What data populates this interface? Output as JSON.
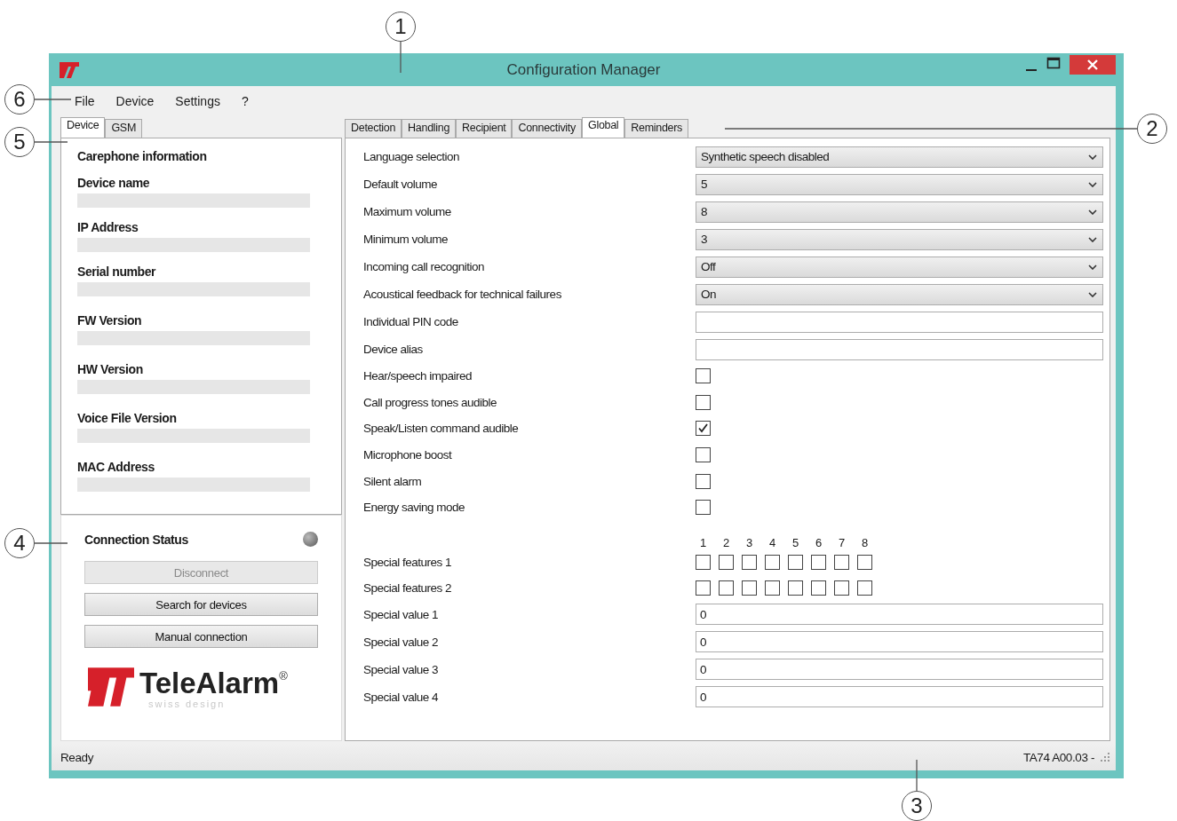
{
  "callouts": [
    {
      "label": "1"
    },
    {
      "label": "6"
    },
    {
      "label": "2"
    },
    {
      "label": "5"
    },
    {
      "label": "4"
    },
    {
      "label": "3"
    }
  ],
  "window": {
    "title": "Configuration Manager"
  },
  "menu": [
    "File",
    "Device",
    "Settings",
    "?"
  ],
  "left_tabs": [
    {
      "label": "Device",
      "selected": true
    },
    {
      "label": "GSM",
      "selected": false
    }
  ],
  "device_info": {
    "heading": "Carephone information",
    "fields": [
      {
        "label": "Device name"
      },
      {
        "label": "IP Address"
      },
      {
        "label": "Serial number"
      },
      {
        "label": "FW Version"
      },
      {
        "label": "HW Version"
      },
      {
        "label": "Voice File Version"
      },
      {
        "label": "MAC Address"
      }
    ]
  },
  "connection": {
    "title": "Connection Status",
    "connected": false,
    "buttons": [
      {
        "label": "Disconnect",
        "disabled": true
      },
      {
        "label": "Search for devices",
        "disabled": false
      },
      {
        "label": "Manual connection",
        "disabled": false
      }
    ]
  },
  "logo": {
    "name": "TeleAlarm",
    "mark": "®",
    "tagline": "swiss design"
  },
  "right_tabs": [
    {
      "label": "Detection",
      "selected": false
    },
    {
      "label": "Handling",
      "selected": false
    },
    {
      "label": "Recipient",
      "selected": false
    },
    {
      "label": "Connectivity",
      "selected": false
    },
    {
      "label": "Global",
      "selected": true
    },
    {
      "label": "Reminders",
      "selected": false
    }
  ],
  "settings": [
    {
      "kind": "select",
      "label": "Language selection",
      "value": "Synthetic speech disabled"
    },
    {
      "kind": "select",
      "label": "Default volume",
      "value": "5"
    },
    {
      "kind": "select",
      "label": "Maximum volume",
      "value": "8"
    },
    {
      "kind": "select",
      "label": "Minimum volume",
      "value": "3"
    },
    {
      "kind": "select",
      "label": "Incoming call recognition",
      "value": "Off"
    },
    {
      "kind": "select",
      "label": "Acoustical feedback for technical failures",
      "value": "On"
    },
    {
      "kind": "text",
      "label": "Individual PIN code"
    },
    {
      "kind": "text",
      "label": "Device alias"
    },
    {
      "kind": "checkbox",
      "label": "Hear/speech impaired",
      "checked": false
    },
    {
      "kind": "checkbox",
      "label": "Call progress tones audible",
      "checked": false
    },
    {
      "kind": "checkbox",
      "label": "Speak/Listen command audible",
      "checked": true
    },
    {
      "kind": "checkbox",
      "label": "Microphone boost",
      "checked": false
    },
    {
      "kind": "checkbox",
      "label": "Silent alarm",
      "checked": false
    },
    {
      "kind": "checkbox",
      "label": "Energy saving mode",
      "checked": false
    },
    {
      "kind": "bit-header",
      "labels": [
        "1",
        "2",
        "3",
        "4",
        "5",
        "6",
        "7",
        "8"
      ]
    },
    {
      "kind": "bits",
      "label": "Special features 1",
      "bits": [
        false,
        false,
        false,
        false,
        false,
        false,
        false,
        false
      ]
    },
    {
      "kind": "bits",
      "label": "Special features 2",
      "bits": [
        false,
        false,
        false,
        false,
        false,
        false,
        false,
        false
      ]
    },
    {
      "kind": "text",
      "label": "Special value 1",
      "value": "0"
    },
    {
      "kind": "text",
      "label": "Special value 2",
      "value": "0"
    },
    {
      "kind": "text",
      "label": "Special value 3",
      "value": "0"
    },
    {
      "kind": "text",
      "label": "Special value 4",
      "value": "0"
    }
  ],
  "status_bar": {
    "left": "Ready",
    "right": "TA74 A00.03 -"
  }
}
